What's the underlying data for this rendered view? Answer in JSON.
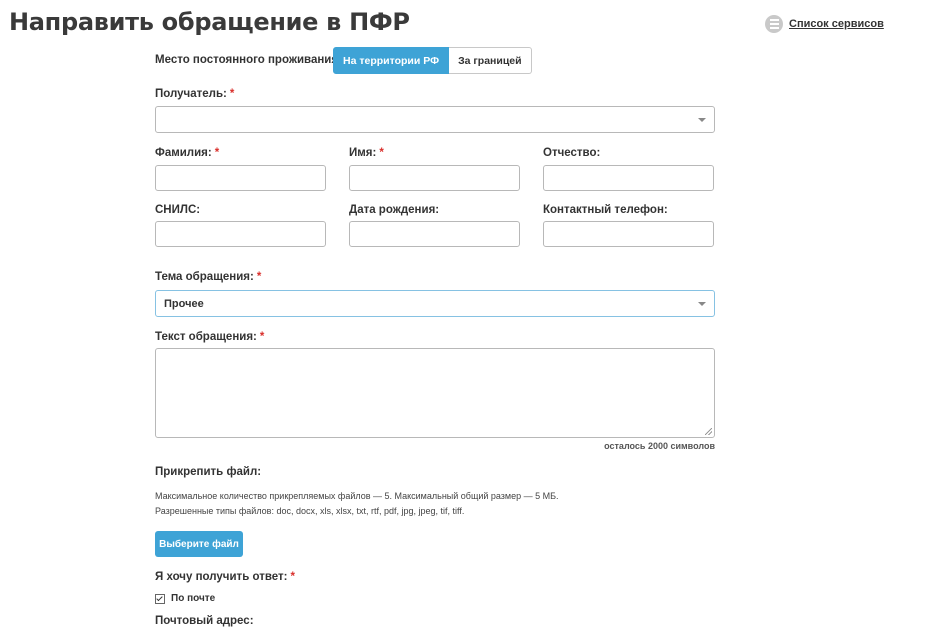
{
  "page": {
    "title": "Направить обращение в ПФР",
    "services_link": "Список сервисов",
    "services_icon": "list-icon"
  },
  "residence": {
    "label": "Место постоянного проживания:",
    "options": [
      "На территории РФ",
      "За границей"
    ],
    "selected": "На территории РФ"
  },
  "recipient": {
    "label": "Получатель:",
    "value": ""
  },
  "fields": {
    "last_name": {
      "label": "Фамилия:",
      "required": true,
      "value": ""
    },
    "first_name": {
      "label": "Имя:",
      "required": true,
      "value": ""
    },
    "patronymic": {
      "label": "Отчество:",
      "required": false,
      "value": ""
    },
    "snils": {
      "label": "СНИЛС:",
      "required": false,
      "value": ""
    },
    "birth_date": {
      "label": "Дата рождения:",
      "required": false,
      "value": ""
    },
    "phone": {
      "label": "Контактный телефон:",
      "required": false,
      "value": ""
    }
  },
  "subject": {
    "label": "Тема обращения:",
    "value": "Прочее"
  },
  "message": {
    "label": "Текст обращения:",
    "value": "",
    "counter": "осталось 2000 символов"
  },
  "attachment": {
    "label": "Прикрепить файл:",
    "hint_1": "Максимальное количество прикрепляемых файлов — 5. Максимальный общий размер — 5 МБ.",
    "hint_2": "Разрешенные типы файлов: doc, docx, xls, xlsx, txt, rtf, pdf, jpg, jpeg, tif, tiff.",
    "button": "Выберите файл"
  },
  "response": {
    "label": "Я хочу получить ответ:",
    "by_mail_label": "По почте",
    "by_mail_checked": true
  },
  "postal_address": {
    "label": "Почтовый адрес:"
  },
  "required_mark": "*"
}
